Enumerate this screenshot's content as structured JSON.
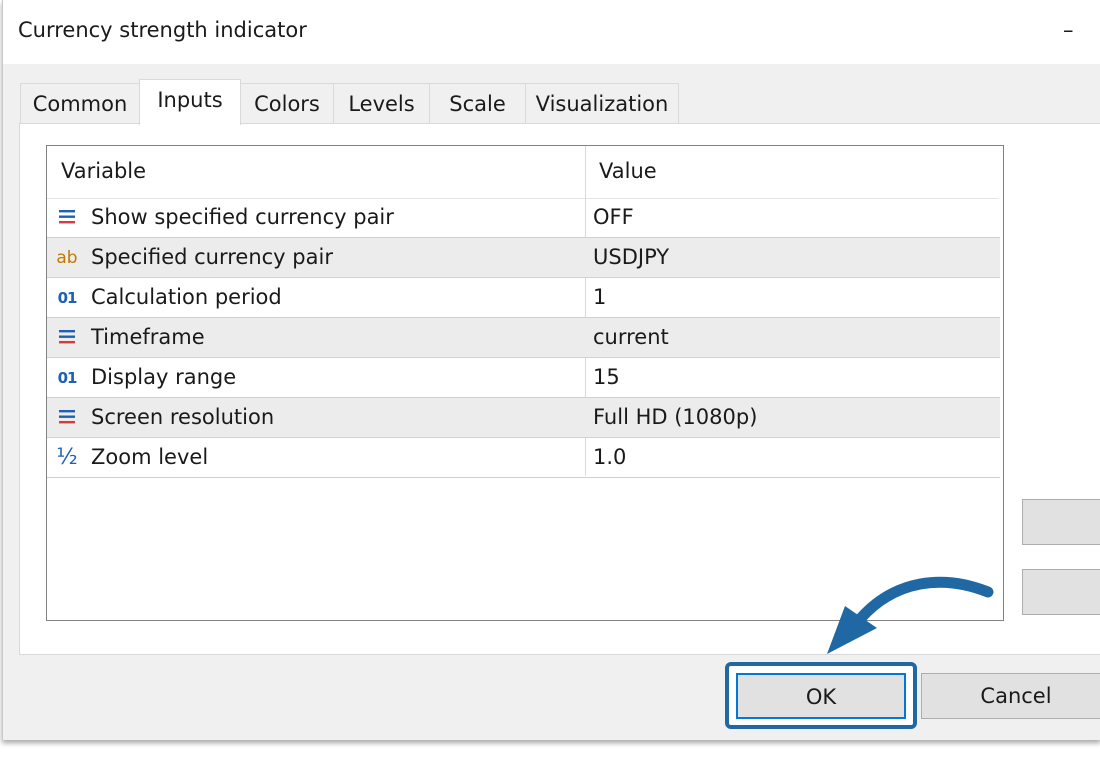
{
  "window": {
    "title": "Currency strength indicator",
    "title_button": "–"
  },
  "tabs": [
    {
      "label": "Common"
    },
    {
      "label": "Inputs",
      "active": true
    },
    {
      "label": "Colors"
    },
    {
      "label": "Levels"
    },
    {
      "label": "Scale"
    },
    {
      "label": "Visualization"
    }
  ],
  "grid": {
    "columns": [
      "Variable",
      "Value"
    ],
    "rows": [
      {
        "icon": "enum-list-icon",
        "name": "Show specified currency pair",
        "value": "OFF"
      },
      {
        "icon": "string-ab-icon",
        "name": "Specified currency pair",
        "value": "USDJPY"
      },
      {
        "icon": "integer-01-icon",
        "name": "Calculation period",
        "value": "1"
      },
      {
        "icon": "enum-list-icon",
        "name": "Timeframe",
        "value": "current"
      },
      {
        "icon": "integer-01-icon",
        "name": "Display range",
        "value": "15"
      },
      {
        "icon": "enum-list-icon",
        "name": "Screen resolution",
        "value": "Full HD (1080p)"
      },
      {
        "icon": "fraction-half-icon",
        "name": "Zoom level",
        "value": "1.0"
      }
    ]
  },
  "buttons": {
    "ok": "OK",
    "cancel": "Cancel"
  },
  "colors": {
    "highlight": "#1f68a3",
    "enum_icon_blue": "#1f5fb5",
    "enum_icon_red": "#d93b3b",
    "string_icon": "#c07a00"
  }
}
